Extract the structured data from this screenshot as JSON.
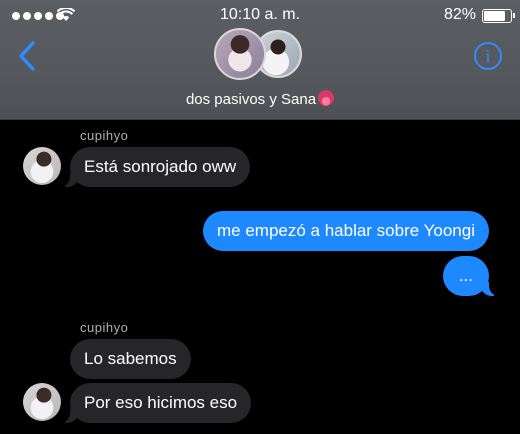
{
  "status_bar": {
    "time": "10:10 a. m.",
    "battery_percent_label": "82%",
    "battery_level": 0.82,
    "signal_dots": 5
  },
  "header": {
    "title": "dos pasivos y Sana",
    "back_icon": "chevron-left-icon",
    "info_icon": "info-circle-icon",
    "info_glyph": "i",
    "accent_color": "#2e8cff"
  },
  "messages": [
    {
      "sender": "cupihyo",
      "text": "Está sonrojado oww",
      "direction": "incoming"
    },
    {
      "text": "me empezó a hablar sobre Yoongi",
      "direction": "outgoing"
    },
    {
      "text": "...",
      "direction": "outgoing"
    },
    {
      "sender": "cupihyo",
      "text": "Lo sabemos",
      "direction": "incoming"
    },
    {
      "text": "Por eso hicimos eso",
      "direction": "incoming"
    }
  ],
  "colors": {
    "outgoing_bubble": "#1e88ff",
    "incoming_bubble": "#262628",
    "background": "#000000"
  }
}
